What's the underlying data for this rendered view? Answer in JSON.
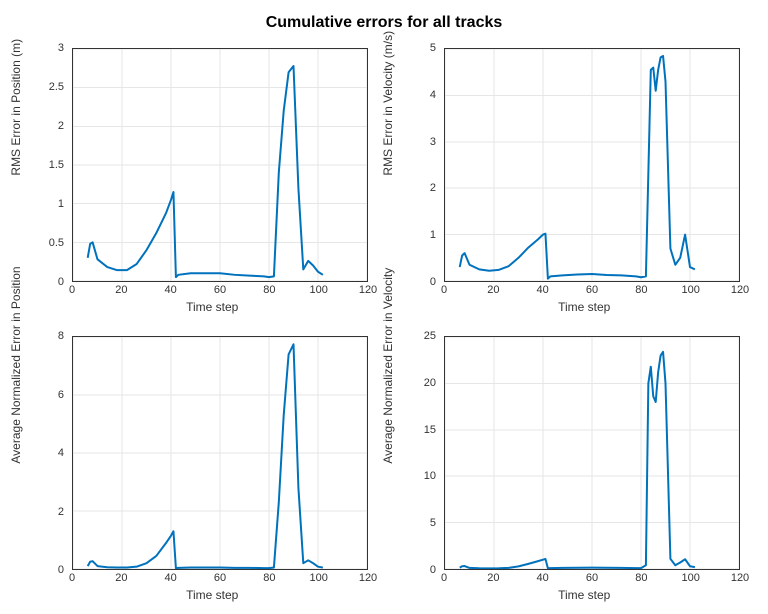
{
  "title": "Cumulative errors for all tracks",
  "line_color": "#0072BD",
  "chart_data": [
    {
      "type": "line",
      "ylabel": "RMS Error in Position (m)",
      "xlabel": "Time step",
      "xlim": [
        0,
        120
      ],
      "ylim": [
        0,
        3
      ],
      "xticks": [
        0,
        20,
        40,
        60,
        80,
        100,
        120
      ],
      "yticks": [
        0,
        0.5,
        1,
        1.5,
        2,
        2.5,
        3
      ],
      "x": [
        6,
        7,
        8,
        10,
        14,
        18,
        22,
        26,
        30,
        34,
        38,
        40,
        41,
        42,
        43,
        48,
        54,
        60,
        66,
        72,
        78,
        80,
        82,
        84,
        86,
        88,
        90,
        92,
        94,
        96,
        98,
        100,
        102
      ],
      "y": [
        0.3,
        0.48,
        0.5,
        0.28,
        0.18,
        0.14,
        0.14,
        0.22,
        0.4,
        0.62,
        0.88,
        1.05,
        1.15,
        0.05,
        0.08,
        0.1,
        0.1,
        0.1,
        0.08,
        0.07,
        0.06,
        0.05,
        0.06,
        1.4,
        2.2,
        2.7,
        2.78,
        1.2,
        0.15,
        0.26,
        0.2,
        0.12,
        0.08
      ]
    },
    {
      "type": "line",
      "ylabel": "RMS Error in Velocity (m/s)",
      "xlabel": "Time step",
      "xlim": [
        0,
        120
      ],
      "ylim": [
        0,
        5
      ],
      "xticks": [
        0,
        20,
        40,
        60,
        80,
        100,
        120
      ],
      "yticks": [
        0,
        1,
        2,
        3,
        4,
        5
      ],
      "x": [
        6,
        7,
        8,
        10,
        14,
        18,
        22,
        26,
        30,
        34,
        38,
        40,
        41,
        42,
        43,
        48,
        54,
        60,
        66,
        72,
        78,
        80,
        82,
        84,
        85,
        86,
        87,
        88,
        89,
        90,
        92,
        94,
        96,
        98,
        100,
        102
      ],
      "y": [
        0.3,
        0.55,
        0.6,
        0.35,
        0.25,
        0.22,
        0.24,
        0.32,
        0.5,
        0.72,
        0.9,
        1.0,
        1.02,
        0.05,
        0.1,
        0.12,
        0.14,
        0.15,
        0.13,
        0.12,
        0.1,
        0.08,
        0.1,
        4.55,
        4.6,
        4.1,
        4.55,
        4.82,
        4.85,
        4.3,
        0.7,
        0.35,
        0.5,
        1.0,
        0.3,
        0.25
      ]
    },
    {
      "type": "line",
      "ylabel": "Average Normalized Error in Position",
      "xlabel": "Time step",
      "xlim": [
        0,
        120
      ],
      "ylim": [
        0,
        8
      ],
      "xticks": [
        0,
        20,
        40,
        60,
        80,
        100,
        120
      ],
      "yticks": [
        0,
        2,
        4,
        6,
        8
      ],
      "x": [
        6,
        7,
        8,
        10,
        14,
        18,
        22,
        26,
        30,
        34,
        38,
        40,
        41,
        42,
        43,
        48,
        54,
        60,
        66,
        72,
        78,
        80,
        82,
        84,
        86,
        88,
        90,
        92,
        94,
        96,
        98,
        100,
        102
      ],
      "y": [
        0.1,
        0.25,
        0.27,
        0.1,
        0.06,
        0.05,
        0.05,
        0.08,
        0.2,
        0.45,
        0.9,
        1.15,
        1.3,
        0.03,
        0.04,
        0.05,
        0.05,
        0.05,
        0.04,
        0.04,
        0.03,
        0.03,
        0.05,
        2.3,
        5.3,
        7.4,
        7.75,
        2.8,
        0.2,
        0.3,
        0.2,
        0.08,
        0.05
      ]
    },
    {
      "type": "line",
      "ylabel": "Average Normalized Error in Velocity",
      "xlabel": "Time step",
      "xlim": [
        0,
        120
      ],
      "ylim": [
        0,
        25
      ],
      "xticks": [
        0,
        20,
        40,
        60,
        80,
        100,
        120
      ],
      "yticks": [
        0,
        5,
        10,
        15,
        20,
        25
      ],
      "x": [
        6,
        7,
        8,
        10,
        14,
        18,
        22,
        26,
        30,
        34,
        38,
        40,
        41,
        42,
        43,
        48,
        54,
        60,
        66,
        72,
        78,
        80,
        82,
        83,
        84,
        85,
        86,
        87,
        88,
        89,
        90,
        92,
        94,
        96,
        98,
        100,
        102
      ],
      "y": [
        0.15,
        0.3,
        0.32,
        0.12,
        0.08,
        0.07,
        0.08,
        0.12,
        0.28,
        0.55,
        0.85,
        1.0,
        1.08,
        0.08,
        0.1,
        0.12,
        0.14,
        0.15,
        0.13,
        0.12,
        0.1,
        0.1,
        0.4,
        20.0,
        21.8,
        18.6,
        18.0,
        21.2,
        23.0,
        23.4,
        20.0,
        1.1,
        0.4,
        0.7,
        1.05,
        0.3,
        0.2
      ]
    }
  ]
}
